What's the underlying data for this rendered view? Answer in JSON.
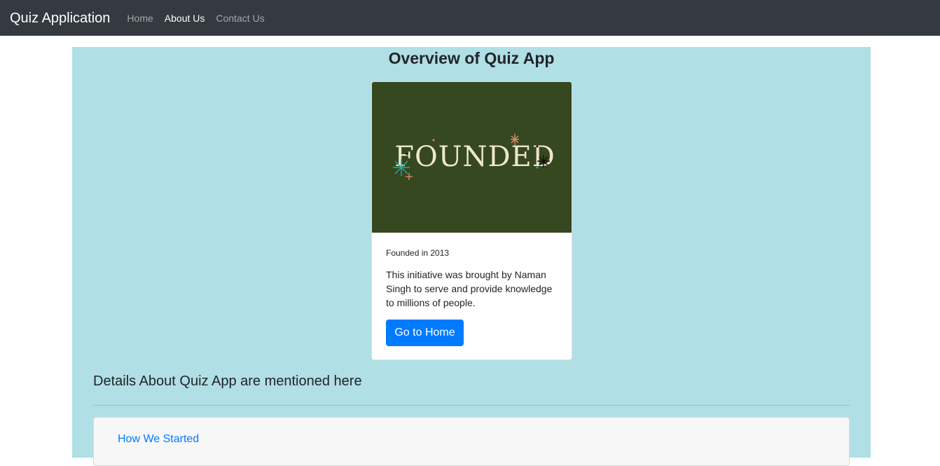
{
  "navbar": {
    "brand": "Quiz Application",
    "links": [
      {
        "label": "Home",
        "active": false
      },
      {
        "label": "About Us",
        "active": true
      },
      {
        "label": "Contact Us",
        "active": false
      }
    ]
  },
  "main": {
    "title": "Overview of Quiz App",
    "card": {
      "image_text": "FOUNDED",
      "image_bg": "#35481f",
      "subtitle": "Founded in 2013",
      "text": "This initiative was brought by Naman Singh to serve and provide knowledge to millions of people.",
      "button_label": "Go to Home"
    },
    "details_heading": "Details About Quiz App are mentioned here",
    "accordion": {
      "link_label": "How We Started"
    }
  },
  "colors": {
    "navbar_bg": "#343a40",
    "panel_bg": "#b0dfe5",
    "primary": "#007bff"
  }
}
